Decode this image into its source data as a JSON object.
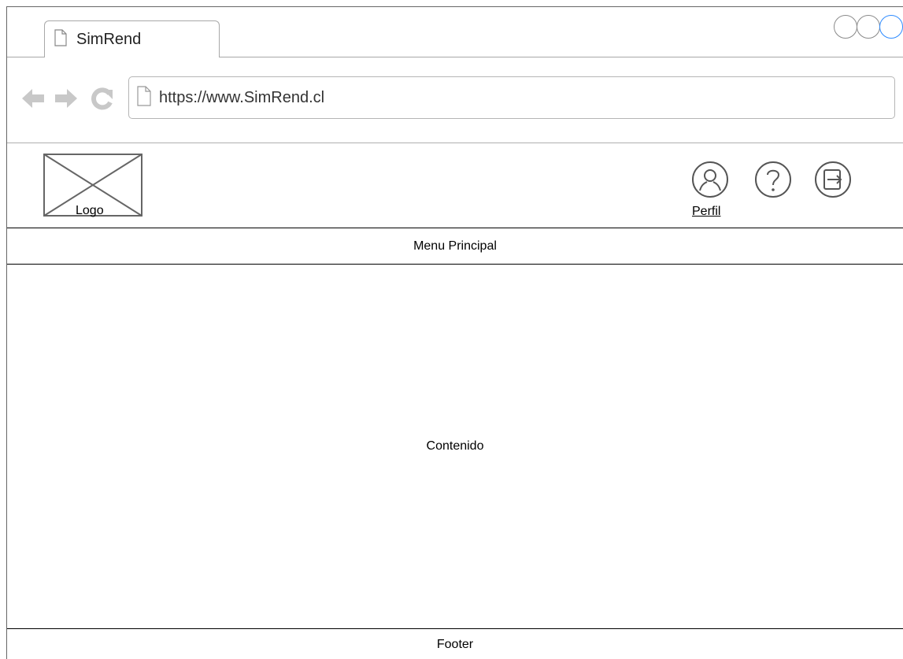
{
  "browser": {
    "tab_title": "SimRend",
    "url": "https://www.SimRend.cl",
    "icons": [
      "page-icon",
      "back-arrow-icon",
      "forward-arrow-icon",
      "reload-icon"
    ]
  },
  "header": {
    "logo_label": "Logo",
    "profile_label": "Perfil",
    "icons": [
      "user-icon",
      "help-icon",
      "logout-icon"
    ]
  },
  "menu": {
    "label": "Menu Principal"
  },
  "content": {
    "label": "Contenido"
  },
  "footer": {
    "label": "Footer"
  },
  "colors": {
    "active_window_button": "#2e8bff",
    "disabled_nav": "#c8c8c8"
  }
}
